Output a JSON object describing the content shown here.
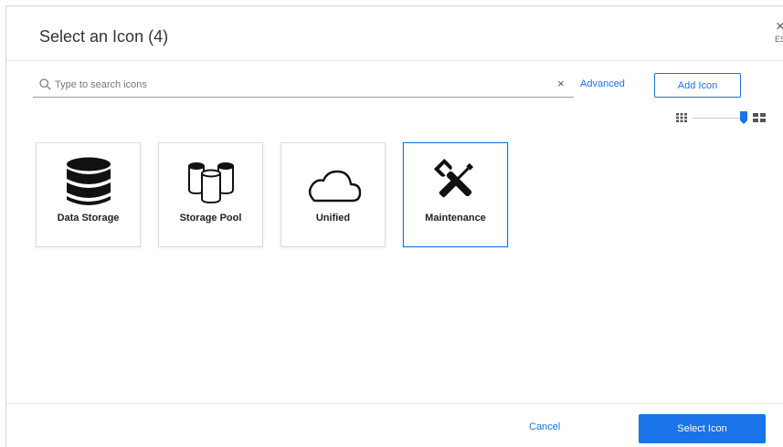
{
  "dialog": {
    "title": "Select an Icon (4)",
    "close_glyph": "×",
    "esc_label": "ESC"
  },
  "search": {
    "placeholder": "Type to search icons",
    "value": "",
    "clear_glyph": "×"
  },
  "toolbar": {
    "advanced_label": "Advanced",
    "add_icon_label": "Add Icon",
    "size_slider_value": 1.0
  },
  "icons": [
    {
      "label": "Data Storage",
      "icon": "database-icon",
      "selected": false
    },
    {
      "label": "Storage Pool",
      "icon": "storage-pool-icon",
      "selected": false
    },
    {
      "label": "Unified",
      "icon": "cloud-icon",
      "selected": false
    },
    {
      "label": "Maintenance",
      "icon": "wrench-screwdriver-icon",
      "selected": true
    }
  ],
  "footer": {
    "cancel_label": "Cancel",
    "select_label": "Select Icon"
  },
  "colors": {
    "accent": "#1a73e8",
    "text": "#333333",
    "border": "#dcdcdc"
  }
}
